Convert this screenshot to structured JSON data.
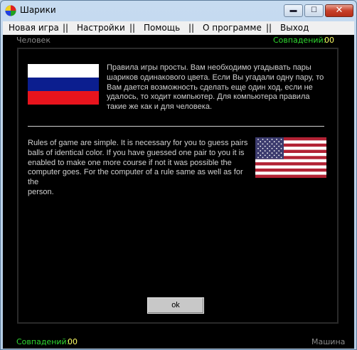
{
  "window": {
    "title": "Шарики",
    "minimize_glyph": "▬",
    "maximize_glyph": "☐",
    "close_glyph": "✕"
  },
  "menu": [
    "Новая игра",
    "||",
    "Настройки",
    "||",
    "Помощь",
    "||",
    "О программе",
    "||",
    "Выход"
  ],
  "top_bar": {
    "player": "Человек",
    "score_label": "Совпадений:",
    "score_value": "00"
  },
  "bottom_bar": {
    "score_label": "Совпадений:",
    "score_value": "00",
    "player": "Машина"
  },
  "rules": {
    "ru_lines": [
      "Правила игры просты. Вам необходимо угадывать пары",
      "шариков одинакового цвета. Если Вы угадали одну пару, то",
      "Вам дается возможность сделать еще один ход, если не",
      "удалось, то ходит компьютер. Для компьютера правила",
      "такие же как и для человека."
    ],
    "en_lines": [
      "Rules of game are simple. It is necessary for you to guess pairs",
      "balls of identical color. If you have guessed one pair to you it is",
      "enabled to make one more course if not it was possible the",
      "computer goes. For the computer of a rule same as well as for the",
      "person."
    ]
  },
  "ok_label": "ok",
  "colors": {
    "background": "#000000",
    "score_label": "#2fd92f",
    "score_value": "#ffff66",
    "player_label": "#8a8a8a",
    "rules_text": "#d0d0d0"
  }
}
